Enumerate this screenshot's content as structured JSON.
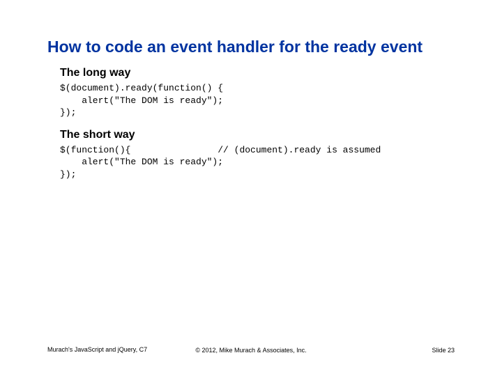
{
  "title": "How to code an event handler for the ready event",
  "sections": {
    "longway": {
      "heading": "The long way",
      "code": "$(document).ready(function() {\n    alert(\"The DOM is ready\");\n});"
    },
    "shortway": {
      "heading": "The short way",
      "code": "$(function(){                // (document).ready is assumed\n    alert(\"The DOM is ready\");\n});"
    }
  },
  "footer": {
    "left": "Murach's JavaScript and jQuery, C7",
    "center": "© 2012, Mike Murach & Associates, Inc.",
    "right": "Slide 23"
  }
}
